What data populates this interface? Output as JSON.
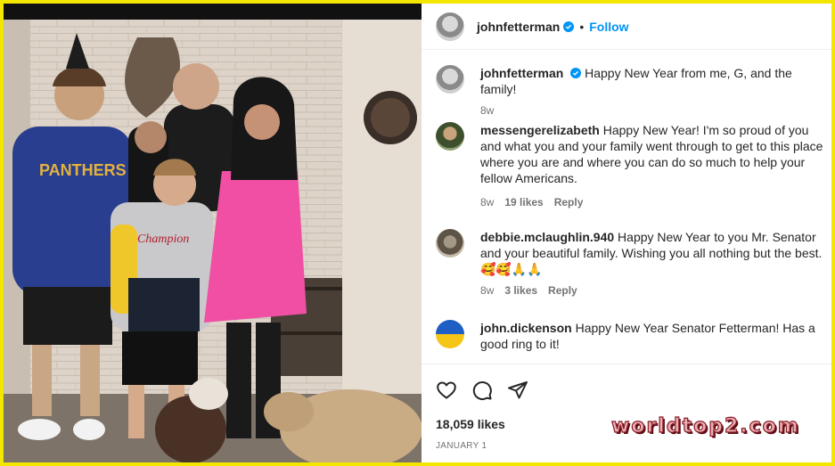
{
  "post": {
    "username": "johnfetterman",
    "follow_label": "Follow",
    "dot": "•"
  },
  "comments": [
    {
      "username": "johnfetterman",
      "text": "Happy New Year from me, G, and the family!",
      "time": "8w",
      "likes": "",
      "reply": "",
      "avatar": "profile-photo",
      "verified": true
    },
    {
      "username": "messengerelizabeth",
      "text": "Happy New Year! I'm so proud of you and what you and your family went through to get to this place where you are and where you can do so much to help your fellow Americans.",
      "time": "8w",
      "likes": "19 likes",
      "reply": "Reply",
      "avatar": "profile-photo"
    },
    {
      "username": "debbie.mclaughlin.940",
      "text": "Happy New Year to you Mr. Senator and your beautiful family. Wishing you all nothing but the best.",
      "emojis": "🥰🥰🙏🙏",
      "time": "8w",
      "likes": "3 likes",
      "reply": "Reply",
      "avatar": "profile-photo"
    },
    {
      "username": "john.dickenson",
      "text": "Happy New Year Senator Fetterman! Has a good ring to it!",
      "time": "",
      "likes": "",
      "reply": "",
      "avatar": "ukraine-flag"
    }
  ],
  "actions": {
    "icons": [
      "heart-icon",
      "comment-icon",
      "share-icon"
    ]
  },
  "likes_count": "18,059 likes",
  "date": "JANUARY 1",
  "watermark": "worldtop2.com",
  "colors": {
    "frame": "#f3e600",
    "follow": "#0095f6",
    "verified": "#0095f6",
    "meta_text": "#737373"
  }
}
